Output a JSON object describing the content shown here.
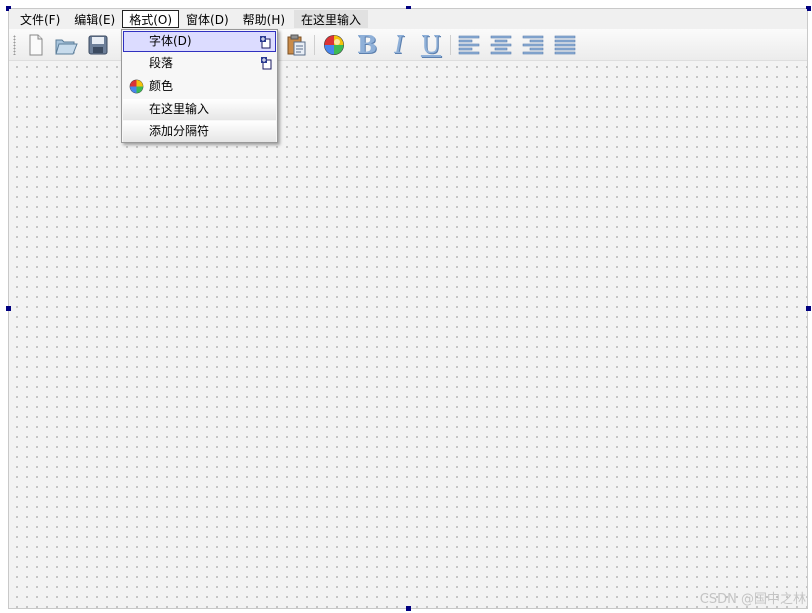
{
  "menubar": {
    "items": [
      {
        "label": "文件(F)"
      },
      {
        "label": "编辑(E)"
      },
      {
        "label": "格式(O)"
      },
      {
        "label": "窗体(D)"
      },
      {
        "label": "帮助(H)"
      }
    ],
    "placeholder": "在这里输入"
  },
  "toolbar": {
    "buttons": [
      {
        "icon": "new-document-icon"
      },
      {
        "icon": "open-folder-icon"
      },
      {
        "icon": "save-icon"
      },
      {
        "icon": "paste-icon"
      },
      {
        "icon": "color-wheel-icon"
      },
      {
        "icon": "bold-icon",
        "label": "B"
      },
      {
        "icon": "italic-icon",
        "label": "I"
      },
      {
        "icon": "underline-icon",
        "label": "U"
      },
      {
        "icon": "align-left-icon"
      },
      {
        "icon": "align-center-icon"
      },
      {
        "icon": "align-right-icon"
      },
      {
        "icon": "align-justify-icon"
      }
    ]
  },
  "format_menu": {
    "items": [
      {
        "label": "字体(D)",
        "has_submenu": true,
        "highlighted": true
      },
      {
        "label": "段落",
        "has_submenu": true
      },
      {
        "label": "颜色",
        "icon": "color-wheel-icon"
      },
      {
        "label": "在这里输入"
      },
      {
        "label": "添加分隔符"
      }
    ]
  },
  "watermark": "CSDN @国中之林",
  "colors": {
    "handle": "#000080",
    "highlight_bg": "#dcdcff",
    "highlight_border": "#3030c0",
    "format_icon": "#8fb0d8"
  }
}
